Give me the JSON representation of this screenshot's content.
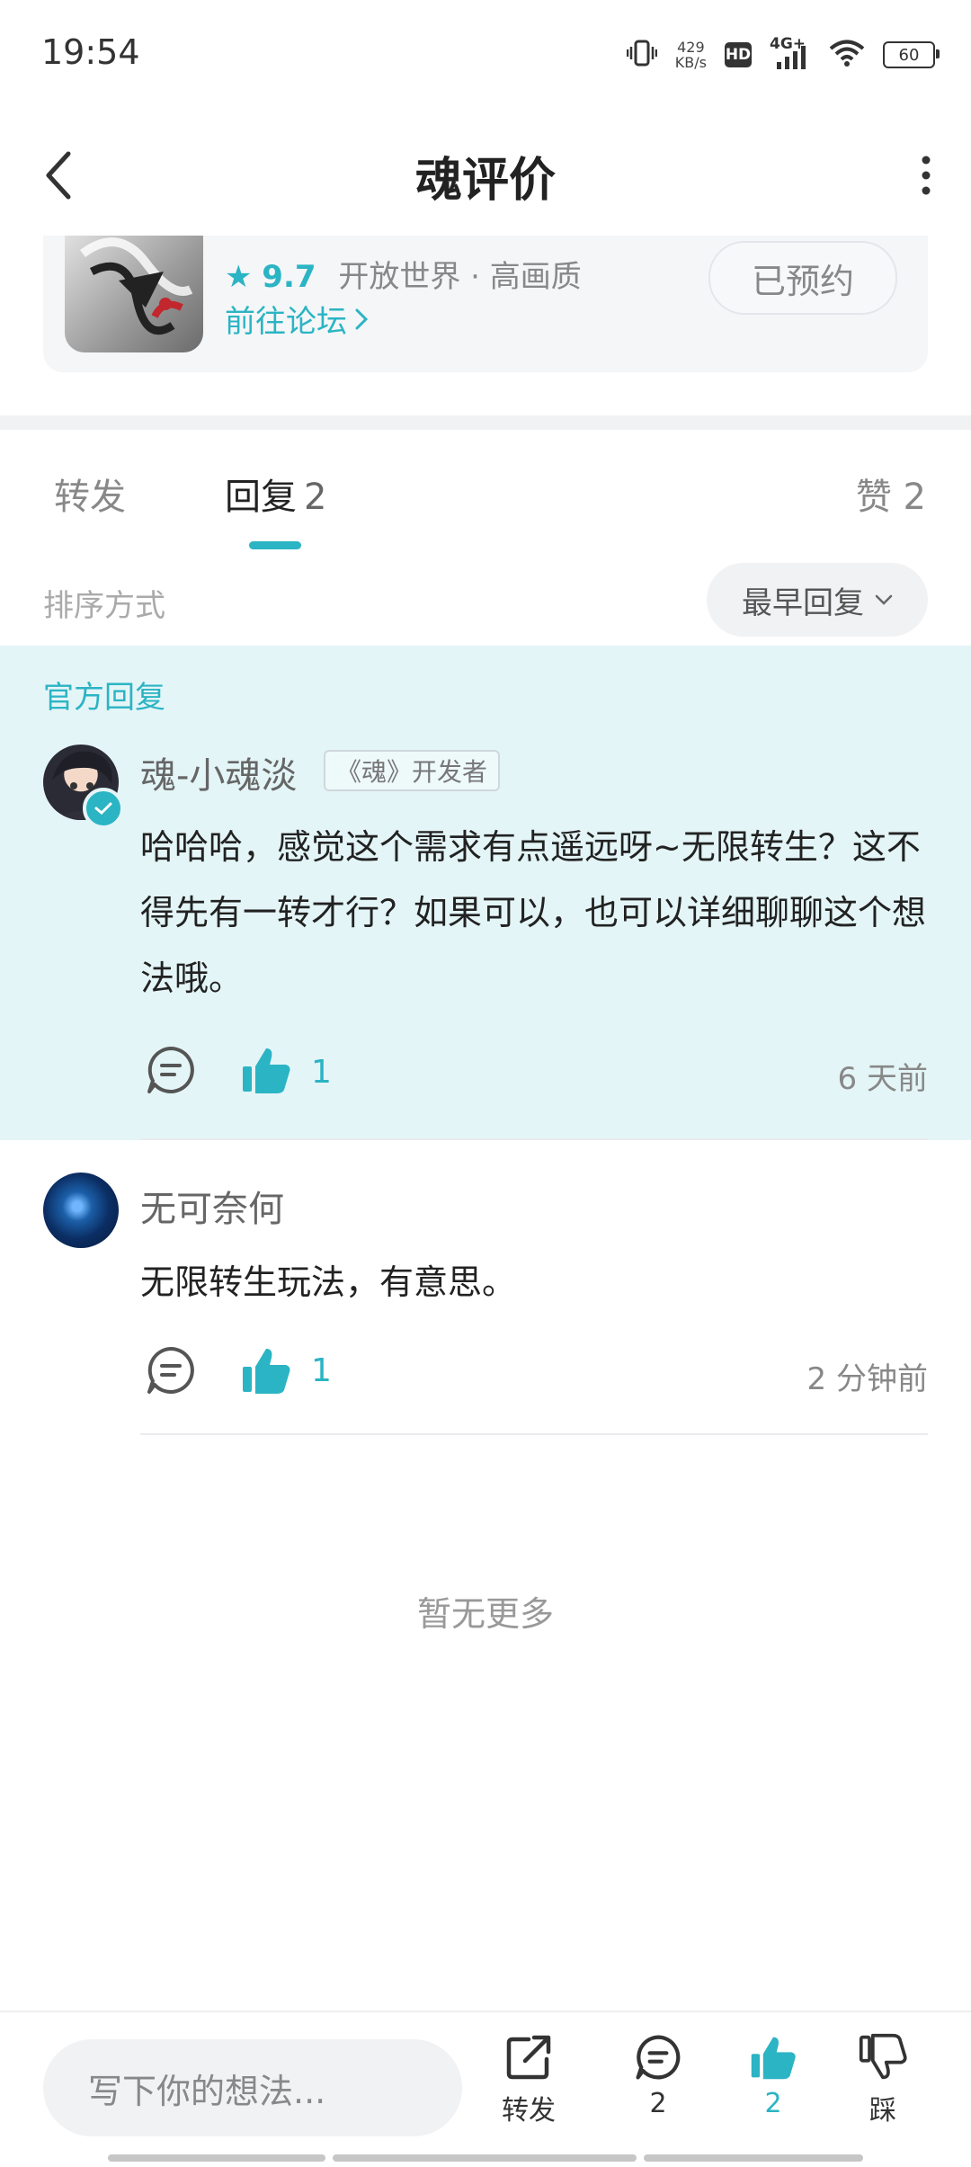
{
  "status_bar": {
    "time": "19:54",
    "net_speed_value": "429",
    "net_speed_unit": "KB/s",
    "hd": "HD",
    "network": "4G+",
    "battery": "60"
  },
  "header": {
    "title": "魂评价"
  },
  "game_card": {
    "rating": "9.7",
    "tags": "开放世界 · 高画质",
    "forum_link": "前往论坛",
    "reserve_button": "已预约"
  },
  "tabs": {
    "repost": "转发",
    "reply": "回复",
    "reply_count": "2",
    "like": "赞 2"
  },
  "sort": {
    "label": "排序方式",
    "selected": "最早回复"
  },
  "official_reply": {
    "section_label": "官方回复",
    "author": "魂-小魂淡",
    "badge": "《魂》开发者",
    "text": "哈哈哈，感觉这个需求有点遥远呀~无限转生？这不得先有一转才行？如果可以，也可以详细聊聊这个想法哦。",
    "likes": "1",
    "time": "6 天前"
  },
  "reply": {
    "author": "无可奈何",
    "text": "无限转生玩法，有意思。",
    "likes": "1",
    "time": "2 分钟前"
  },
  "footer_note": "暂无更多",
  "bottom_bar": {
    "input_placeholder": "写下你的想法...",
    "repost_label": "转发",
    "comment_count": "2",
    "like_count": "2",
    "dislike_label": "踩"
  },
  "colors": {
    "accent": "#2bb4c4",
    "official_bg": "#e4f5f7"
  }
}
